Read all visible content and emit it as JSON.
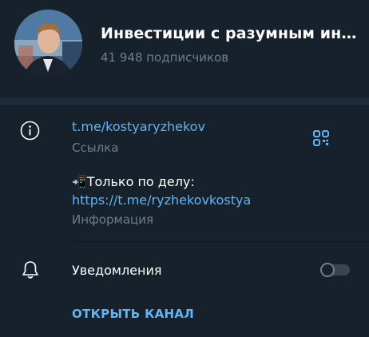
{
  "channel": {
    "title": "Инвестиции с разумным инвес...",
    "subscribers": "41 948 подписчиков"
  },
  "link": {
    "url": "t.me/kostyaryzhekov",
    "caption": "Ссылка"
  },
  "description": {
    "emoji": "📲",
    "line1": "Только по делу:",
    "url": "https://t.me/ryzhekovkostya",
    "caption": "Информация"
  },
  "notifications": {
    "label": "Уведомления",
    "enabled": false
  },
  "open_button": "ОТКРЫТЬ КАНАЛ",
  "icons": [
    "info-icon",
    "qr-code-icon",
    "bell-icon"
  ],
  "colors": {
    "background": "#17212b",
    "separator": "#1e2c3a",
    "accent": "#5eb5f7",
    "muted": "#6d7f8f"
  }
}
